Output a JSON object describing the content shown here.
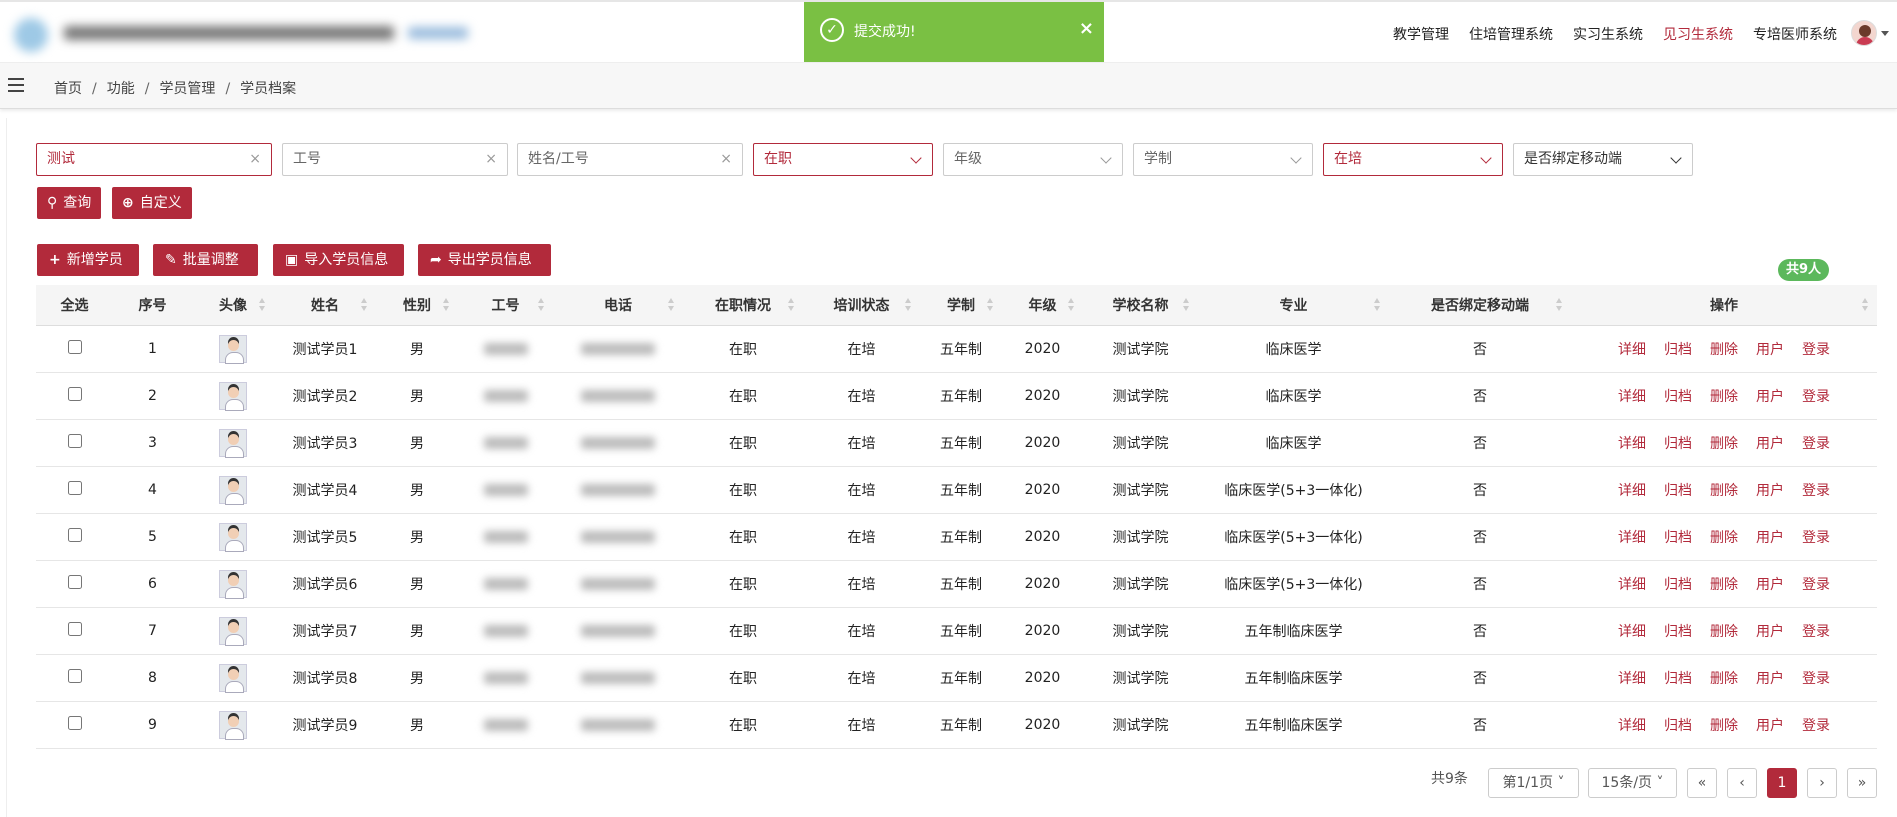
{
  "toast": {
    "message": "提交成功!",
    "close": "×",
    "icon": "check-circle-icon"
  },
  "topnav": {
    "items": [
      "教学管理",
      "住培管理系统",
      "实习生系统",
      "见习生系统",
      "专培医师系统"
    ],
    "active_index": 3
  },
  "breadcrumb": {
    "items": [
      "首页",
      "功能",
      "学员管理",
      "学员档案"
    ],
    "separator": "/"
  },
  "filters": {
    "keyword": {
      "value": "测试"
    },
    "work_id": {
      "placeholder": "工号"
    },
    "name_id": {
      "placeholder": "姓名/工号"
    },
    "employment": {
      "value": "在职"
    },
    "grade": {
      "placeholder": "年级"
    },
    "system": {
      "placeholder": "学制"
    },
    "training": {
      "value": "在培"
    },
    "mobile_bound": {
      "placeholder": "是否绑定移动端"
    },
    "clear_icon": "×"
  },
  "buttons": {
    "query": "查询",
    "custom": "自定义",
    "add": "新增学员",
    "batch": "批量调整",
    "import": "导入学员信息",
    "export": "导出学员信息"
  },
  "icons": {
    "query": "search-icon",
    "custom": "zoom-icon",
    "add": "plus-icon",
    "batch": "edit-icon",
    "import": "file-excel-icon",
    "export": "share-icon"
  },
  "total_badge": "共9人",
  "table": {
    "headers": [
      "全选",
      "序号",
      "头像",
      "姓名",
      "性别",
      "工号",
      "电话",
      "在职情况",
      "培训状态",
      "学制",
      "年级",
      "学校名称",
      "专业",
      "是否绑定移动端",
      "操作"
    ],
    "actions": [
      "详细",
      "归档",
      "删除",
      "用户",
      "登录"
    ],
    "rows": [
      {
        "no": "1",
        "name": "测试学员1",
        "gender": "男",
        "status": "在职",
        "training": "在培",
        "system": "五年制",
        "grade": "2020",
        "school": "测试学院",
        "major": "临床医学",
        "mobile": "否"
      },
      {
        "no": "2",
        "name": "测试学员2",
        "gender": "男",
        "status": "在职",
        "training": "在培",
        "system": "五年制",
        "grade": "2020",
        "school": "测试学院",
        "major": "临床医学",
        "mobile": "否"
      },
      {
        "no": "3",
        "name": "测试学员3",
        "gender": "男",
        "status": "在职",
        "training": "在培",
        "system": "五年制",
        "grade": "2020",
        "school": "测试学院",
        "major": "临床医学",
        "mobile": "否"
      },
      {
        "no": "4",
        "name": "测试学员4",
        "gender": "男",
        "status": "在职",
        "training": "在培",
        "system": "五年制",
        "grade": "2020",
        "school": "测试学院",
        "major": "临床医学(5+3一体化)",
        "mobile": "否"
      },
      {
        "no": "5",
        "name": "测试学员5",
        "gender": "男",
        "status": "在职",
        "training": "在培",
        "system": "五年制",
        "grade": "2020",
        "school": "测试学院",
        "major": "临床医学(5+3一体化)",
        "mobile": "否"
      },
      {
        "no": "6",
        "name": "测试学员6",
        "gender": "男",
        "status": "在职",
        "training": "在培",
        "system": "五年制",
        "grade": "2020",
        "school": "测试学院",
        "major": "临床医学(5+3一体化)",
        "mobile": "否"
      },
      {
        "no": "7",
        "name": "测试学员7",
        "gender": "男",
        "status": "在职",
        "training": "在培",
        "system": "五年制",
        "grade": "2020",
        "school": "测试学院",
        "major": "五年制临床医学",
        "mobile": "否"
      },
      {
        "no": "8",
        "name": "测试学员8",
        "gender": "男",
        "status": "在职",
        "training": "在培",
        "system": "五年制",
        "grade": "2020",
        "school": "测试学院",
        "major": "五年制临床医学",
        "mobile": "否"
      },
      {
        "no": "9",
        "name": "测试学员9",
        "gender": "男",
        "status": "在职",
        "training": "在培",
        "system": "五年制",
        "grade": "2020",
        "school": "测试学院",
        "major": "五年制临床医学",
        "mobile": "否"
      }
    ]
  },
  "pagination": {
    "total": "共9条",
    "page": "第1/1页",
    "page_size": "15条/页",
    "first": "«",
    "prev": "‹",
    "current": "1",
    "next": "›",
    "last": "»"
  },
  "colors": {
    "primary": "#b22a3b",
    "toast": "#7ac043",
    "badge": "#5cb85c"
  }
}
